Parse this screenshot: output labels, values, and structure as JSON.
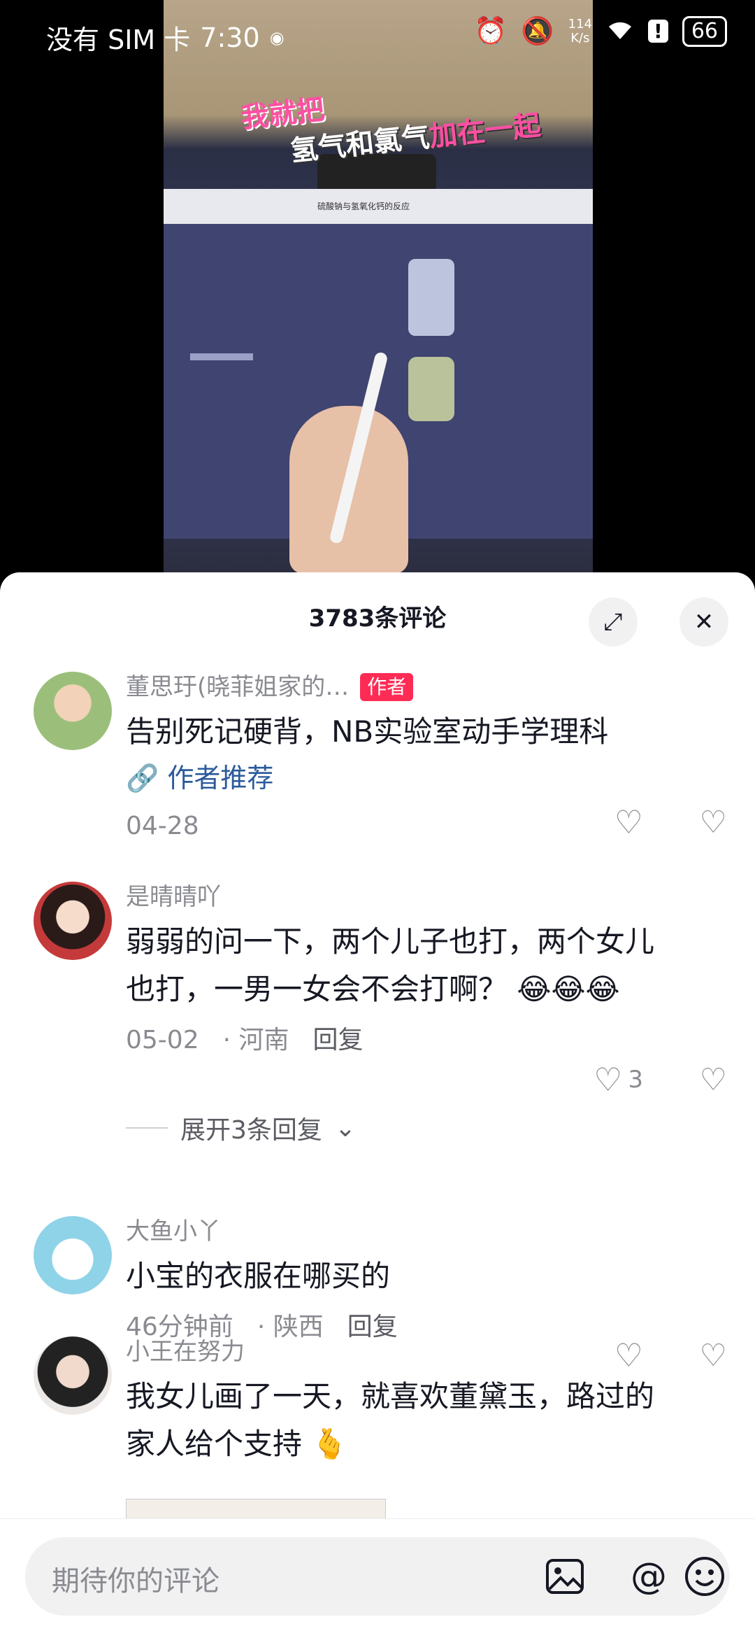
{
  "status_bar": {
    "sim": "没有 SIM 卡",
    "time": "7:30",
    "speed_top": "114",
    "speed_bottom": "K/s",
    "battery": "66"
  },
  "video": {
    "caption_line1": "我就把",
    "caption_line2_a": "氢气和氯气",
    "caption_line2_b": "加在一起",
    "board_title": "硫酸钠与氢氧化钙的反应"
  },
  "comments_header": {
    "title": "3783条评论",
    "expand_icon": "expand-icon",
    "close_icon": "close-icon"
  },
  "comments": [
    {
      "username": "董思玗(晓菲姐家的…",
      "tag": "作者",
      "text": "告别死记硬背，NB实验室动手学理科",
      "link": "作者推荐",
      "date": "04-28",
      "location": "",
      "reply": "",
      "likes": ""
    },
    {
      "username": "是晴晴吖",
      "text_line1": "弱弱的问一下，两个儿子也打，两个女儿",
      "text_line2": "也打，一男一女会不会打啊？",
      "emoji": "😂😂😂",
      "date": "05-02",
      "location": "河南",
      "reply": "回复",
      "likes": "3",
      "expand": "展开3条回复"
    },
    {
      "username": "大鱼小丫",
      "text": "小宝的衣服在哪买的",
      "date": "46分钟前",
      "location": "陕西",
      "reply": "回复"
    },
    {
      "username": "小王在努力",
      "text_line1": "我女儿画了一天，就喜欢董黛玉，路过的",
      "text_line2": "家人给个支持",
      "emoji": "🫰"
    }
  ],
  "input_bar": {
    "placeholder": "期待你的评论",
    "icons": [
      "image-icon",
      "at-icon",
      "emoji-icon"
    ]
  },
  "colors": {
    "accent": "#fe2c55",
    "link": "#2b5a9c",
    "muted": "#8a8b91"
  }
}
